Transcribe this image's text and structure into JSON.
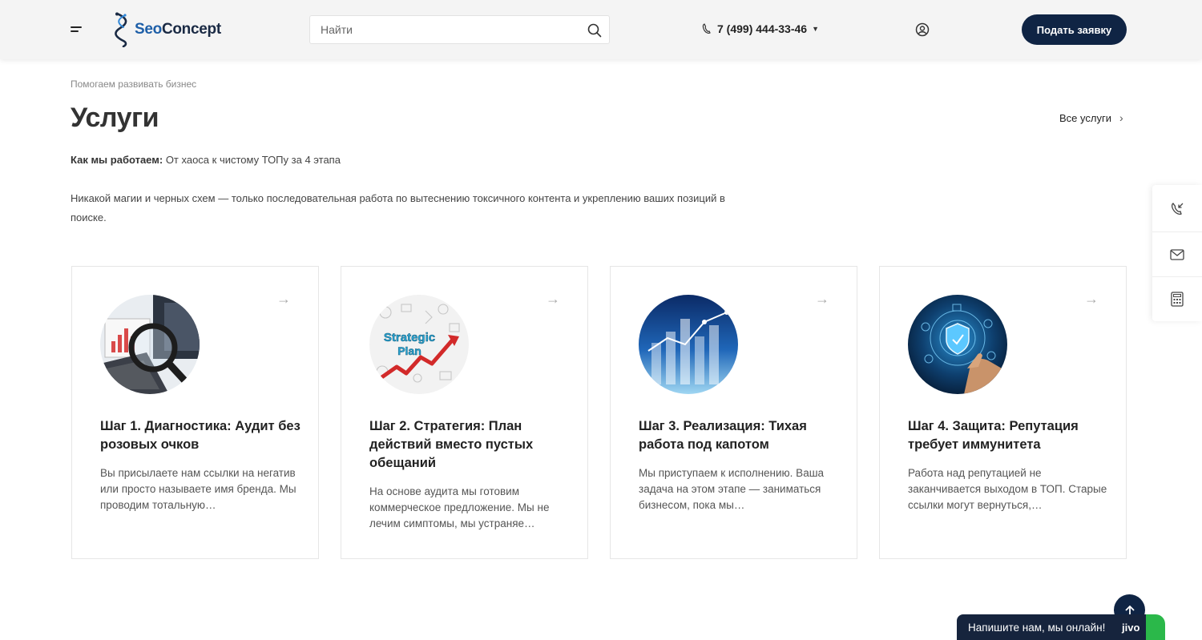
{
  "header": {
    "logo": {
      "seo": "Seo",
      "concept": "Concept"
    },
    "search_placeholder": "Найти",
    "phone": "7 (499) 444-33-46",
    "cta_label": "Подать заявку"
  },
  "section": {
    "tagline": "Помогаем развивать бизнес",
    "title": "Услуги",
    "all_link": "Все услуги",
    "how_label": "Как мы работаем:",
    "how_text": " От хаоса к чистому ТОПу за 4 этапа",
    "description": "Никакой магии и черных схем — только последовательная работа по вытеснению токсичного контента и укреплению ваших позиций в поиске."
  },
  "cards": [
    {
      "title": "Шаг 1. Диагностика: Аудит без розовых очков",
      "text": "Вы присылаете нам ссылки на негатив или просто называете имя бренда. Мы проводим тотальную…"
    },
    {
      "title": "Шаг 2. Стратегия: План действий вместо пустых обещаний",
      "text": "На основе аудита мы готовим коммерческое предложение. Мы не лечим симптомы, мы устраняе…",
      "image_text_1": "Strategic",
      "image_text_2": "Plan"
    },
    {
      "title": "Шаг 3. Реализация: Тихая работа под капотом",
      "text": "Мы приступаем к исполнению. Ваша задача на этом этапе — заниматься бизнесом, пока мы…"
    },
    {
      "title": "Шаг 4. Защита: Репутация требует иммунитета",
      "text": "Работа над репутацией не заканчивается выходом в ТОП. Старые ссылки могут вернуться,…"
    }
  ],
  "chat": {
    "label": "Напишите нам, мы онлайн!",
    "brand": "jivo"
  },
  "colors": {
    "primary_dark": "#0f2444",
    "logo_blue": "#1e5fa8",
    "chat_green": "#2bb84a"
  }
}
